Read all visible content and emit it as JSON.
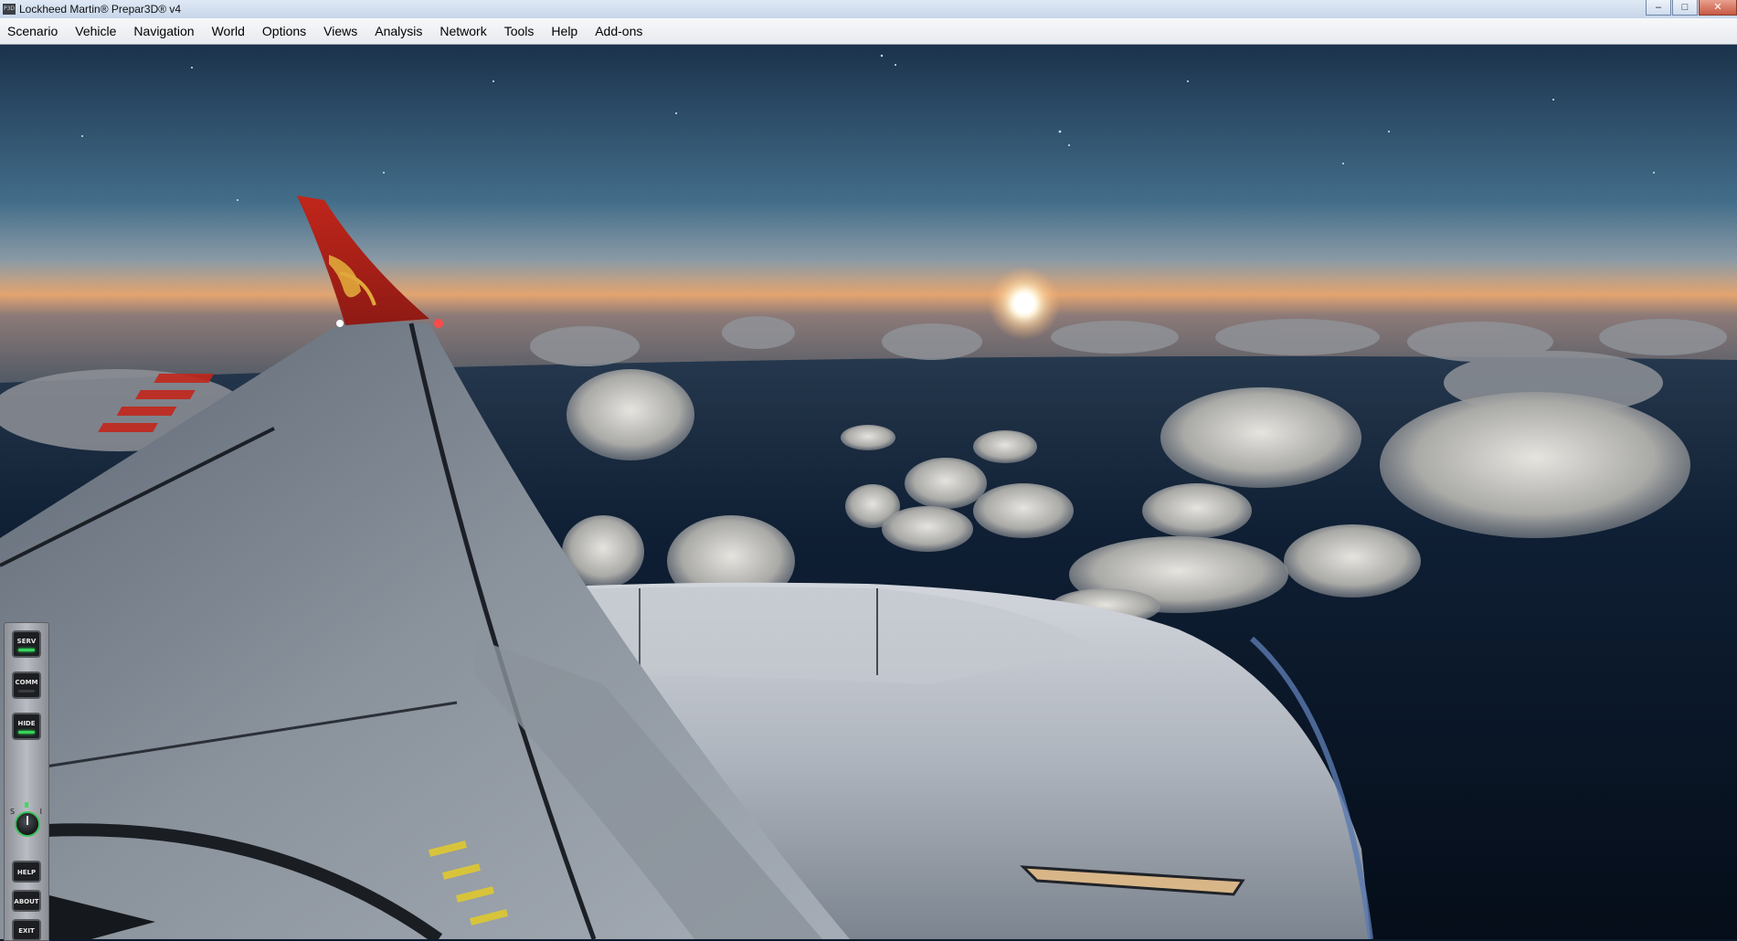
{
  "window": {
    "title": "Lockheed Martin® Prepar3D® v4",
    "icon_text": "P3D",
    "controls": {
      "minimize": "–",
      "maximize": "□",
      "close": "✕"
    }
  },
  "menu": {
    "items": [
      {
        "id": "scenario",
        "label": "Scenario"
      },
      {
        "id": "vehicle",
        "label": "Vehicle"
      },
      {
        "id": "navigation",
        "label": "Navigation"
      },
      {
        "id": "world",
        "label": "World"
      },
      {
        "id": "options",
        "label": "Options"
      },
      {
        "id": "views",
        "label": "Views"
      },
      {
        "id": "analysis",
        "label": "Analysis"
      },
      {
        "id": "network",
        "label": "Network"
      },
      {
        "id": "tools",
        "label": "Tools"
      },
      {
        "id": "help",
        "label": "Help"
      },
      {
        "id": "addons",
        "label": "Add-ons"
      }
    ]
  },
  "scene": {
    "description_icon": "aircraft-wing-view",
    "colors": {
      "sky_top": "#1d3550",
      "sky_mid": "#3f6b86",
      "horizon_glow": "#e8a56c",
      "ocean": "#0a1628",
      "wing": "#7c8591",
      "tail_red": "#c8261c",
      "tail_gold": "#e0a83a"
    }
  },
  "side_panel": {
    "buttons": {
      "serv": "SERV",
      "comm": "COMM",
      "hide": "HIDE",
      "help": "HELP",
      "about": "ABOUT",
      "exit": "EXIT"
    },
    "knob": {
      "left_label": "S",
      "right_label": "I"
    }
  }
}
